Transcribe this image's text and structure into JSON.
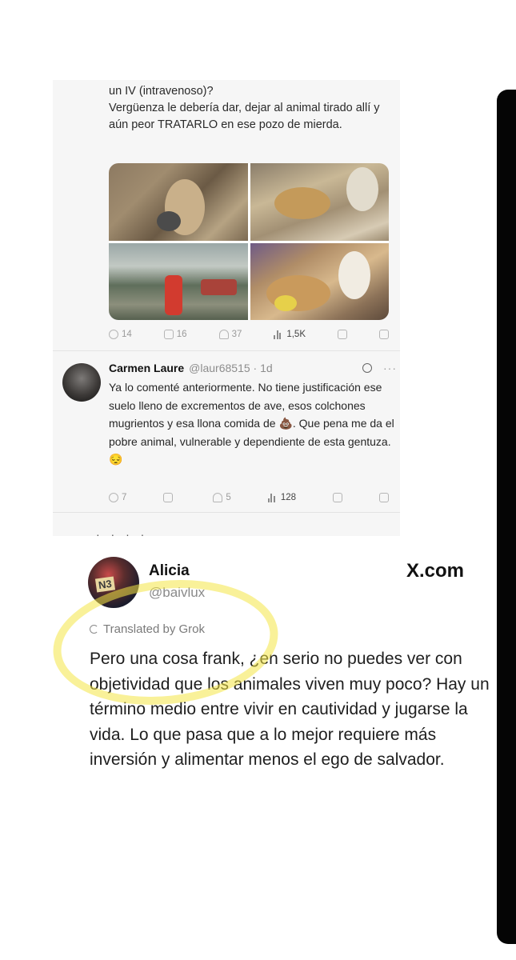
{
  "screenshot_tweet": {
    "text": "un IV (intravenoso)?\nVergüenza le debería dar, dejar al animal tirado allí y aún peor TRATARLO en ese pozo de mierda.",
    "images": [
      "photo-1",
      "photo-2",
      "photo-3",
      "photo-4"
    ],
    "actions": {
      "replies": "14",
      "reposts": "16",
      "likes": "37",
      "views": "1,5K"
    }
  },
  "reply": {
    "name": "Carmen Laure",
    "handle": "@laur68515 · 1d",
    "text": "Ya lo comenté anteriormente. No tiene justificación ese suelo lleno de excrementos de ave, esos colchones mugrientos y esa llona comida de 💩. Que pena me da el pobre animal, vulnerable y dependiente de esta gentuza. 😔",
    "actions": {
      "replies": "7",
      "reposts": "",
      "likes": "5",
      "views": "128"
    }
  },
  "main_post": {
    "name": "Alicia",
    "handle": "@baivlux",
    "site": "X.com",
    "avatar_tag": "N3",
    "translated_label": "Translated by Grok",
    "text": "Pero una cosa frank, ¿en serio no puedes ver con objetividad que los animales viven muy poco? Hay un término medio entre vivir en cautividad y jugarse la vida. Lo que pasa que a lo mejor requiere más inversión y alimentar menos el ego de salvador."
  },
  "separator": "·  · · ·",
  "colors": {
    "highlight": "#f4e646",
    "right_bar": "#050505",
    "screenshot_bg": "#f6f6f6"
  }
}
